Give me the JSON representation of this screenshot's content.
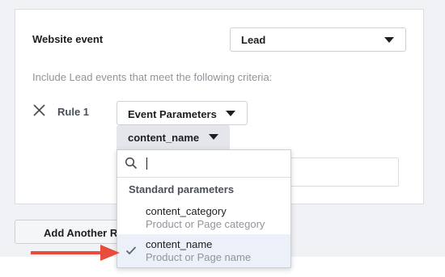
{
  "event": {
    "label": "Website event",
    "value": "Lead"
  },
  "criteria_text": "Include Lead events that meet the following criteria:",
  "rule": {
    "label": "Rule 1",
    "parameter_button": "Event Parameters",
    "parameter_select": "content_name"
  },
  "add_rule": {
    "label": "Add Another R"
  },
  "dropdown": {
    "search_value": "",
    "section_header": "Standard parameters",
    "options": [
      {
        "name": "content_category",
        "description": "Product or Page category"
      },
      {
        "name": "content_name",
        "description": "Product or Page name"
      }
    ],
    "selected_index": 1
  },
  "colors": {
    "accent_arrow": "#e74c3c",
    "selected_row": "#ebf0f9",
    "muted_text": "#90949c"
  },
  "icons": [
    "close-icon",
    "chevron-down-icon",
    "search-icon",
    "check-icon",
    "arrow-icon"
  ]
}
